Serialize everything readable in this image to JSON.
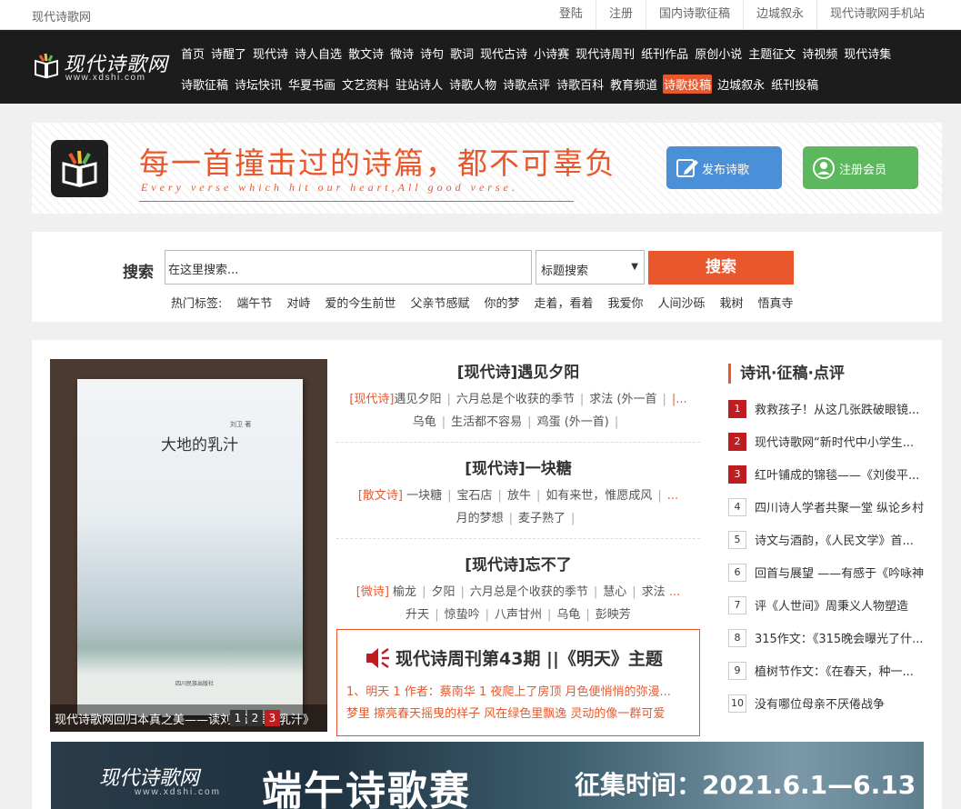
{
  "topbar": {
    "site_name": "现代诗歌网",
    "links": [
      "登陆",
      "注册",
      "国内诗歌征稿",
      "边城叙永",
      "现代诗歌网手机站"
    ]
  },
  "logo": {
    "name": "现代诗歌网",
    "url": "www.xdshi.com"
  },
  "nav": {
    "row1": [
      "首页",
      "诗醒了",
      "现代诗",
      "诗人自选",
      "散文诗",
      "微诗",
      "诗句",
      "歌词",
      "现代古诗",
      "小诗赛",
      "现代诗周刊",
      "纸刊作品",
      "原创小说",
      "主题征文",
      "诗视频",
      "现代诗集"
    ],
    "row2": [
      "诗歌征稿",
      "诗坛快讯",
      "华夏书画",
      "文艺资料",
      "驻站诗人",
      "诗歌人物",
      "诗歌点评",
      "诗歌百科",
      "教育频道",
      "诗歌投稿",
      "边城叙永",
      "纸刊投稿"
    ],
    "active": "诗歌投稿"
  },
  "banner": {
    "slogan": "每一首撞击过的诗篇，都不可辜负",
    "sub": "Every verse which  hit our heart,All good verse.",
    "publish_label": "发布诗歌",
    "register_label": "注册会员"
  },
  "search": {
    "label": "搜索",
    "placeholder": "在这里搜索...",
    "select_value": "标题搜索",
    "button_label": "搜索",
    "tags_label": "热门标签:",
    "tags": [
      "端午节",
      "对峙",
      "爱的今生前世",
      "父亲节感赋",
      "你的梦",
      "走着，看着",
      "我爱你",
      "人间沙砾",
      "栽树",
      "悟真寺"
    ]
  },
  "slideshow": {
    "caption": "现代诗歌网回归本真之美——读刘卫诗集《乳汁》",
    "book_title": "大地的乳汁",
    "book_author": "刘卫 著",
    "book_publisher": "四川民族出版社",
    "pages": [
      "1",
      "2",
      "3"
    ],
    "active_page": "3"
  },
  "articles": [
    {
      "title": "[现代诗]遇见夕阳",
      "cat": "[现代诗]",
      "line1": [
        "遇见夕阳",
        "六月总是个收获的季节",
        "求法 (外一首"
      ],
      "line1_tail": "|...",
      "line2": [
        "乌龟",
        "生活都不容易",
        "鸡蛋 (外一首)"
      ]
    },
    {
      "title": "[现代诗]一块糖",
      "cat": "[散文诗]",
      "line1": [
        "一块糖",
        "宝石店",
        "放牛",
        "如有来世，惟愿成风"
      ],
      "line1_tail": "...",
      "line2": [
        "月的梦想",
        "麦子熟了"
      ]
    },
    {
      "title": "[现代诗]忘不了",
      "cat": "[微诗]",
      "line1": [
        "榆龙",
        "夕阳",
        "六月总是个收获的季节",
        "慧心",
        "求法"
      ],
      "line1_tail": "...",
      "line2": [
        "升天",
        "惊蛰吟",
        "八声甘州",
        "乌龟",
        "彭映芳"
      ]
    }
  ],
  "weekly": {
    "title": "现代诗周刊第43期 ||《明天》主题",
    "line1": "1、明天 1 作者：蔡南华 1 夜爬上了房顶 月色便悄悄的弥漫...",
    "line2": "梦里 擦亮春天摇曳的样子 风在绿色里飘逸 灵动的像一群可爱"
  },
  "sidebar": {
    "heading": "诗讯·征稿·点评",
    "items": [
      "救救孩子！从这几张跌破眼镜...",
      "现代诗歌网“新时代中小学生...",
      "红叶铺成的锦毯——《刘俊平...",
      "四川诗人学者共聚一堂 纵论乡村",
      "诗文与酒韵，《人民文学》首...",
      "回首与展望 ——有感于《吟咏神",
      "评《人世间》周秉义人物塑造",
      "315作文：《315晚会曝光了什...",
      "植树节作文：《在春天，种一...",
      "没有哪位母亲不厌倦战争"
    ]
  },
  "ad": {
    "logo": "现代诗歌网",
    "url": "www.xdshi.com",
    "title": "端午诗歌赛",
    "date": "征集时间：2021.6.1—6.13"
  },
  "colors": {
    "accent": "#e9582c",
    "nav_bg": "#1c1c1c",
    "hot": "#c01d21",
    "publish": "#4a90d9",
    "register": "#5cb85c"
  }
}
